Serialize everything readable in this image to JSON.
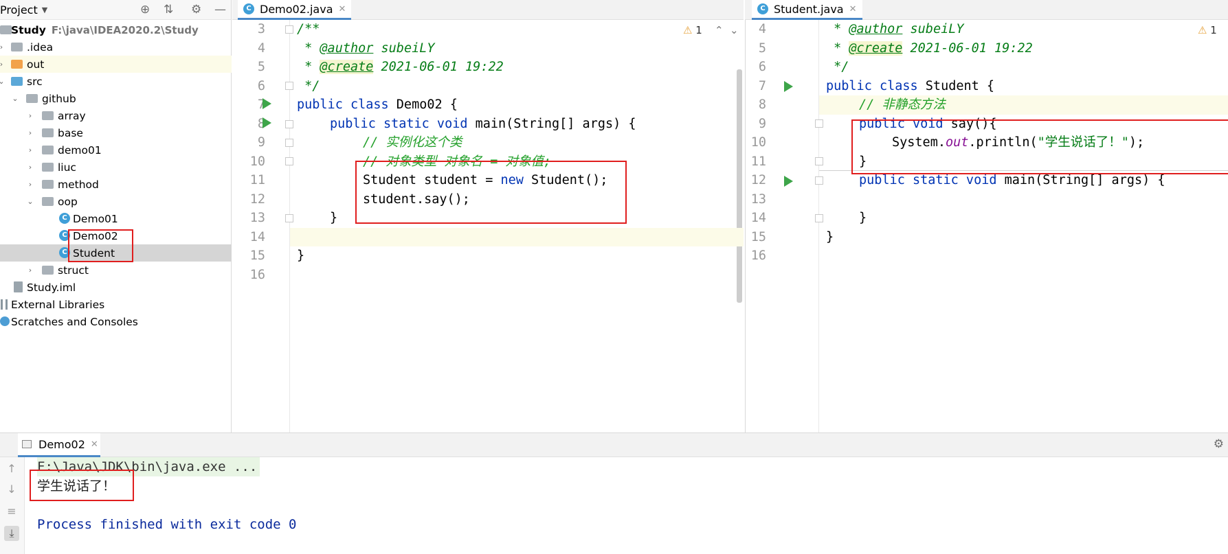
{
  "project_panel": {
    "title": "Project",
    "tree": [
      {
        "label": "Study",
        "path": "F:\\java\\IDEA2020.2\\Study",
        "icon": "module-folder-icon",
        "bold": true
      },
      {
        "label": ".idea",
        "icon": "folder-icon"
      },
      {
        "label": "out",
        "icon": "folder-orange-icon"
      },
      {
        "label": "src",
        "icon": "source-folder-icon"
      },
      {
        "label": "github",
        "icon": "package-icon"
      },
      {
        "label": "array",
        "icon": "package-icon"
      },
      {
        "label": "base",
        "icon": "package-icon"
      },
      {
        "label": "demo01",
        "icon": "package-icon"
      },
      {
        "label": "liuc",
        "icon": "package-icon"
      },
      {
        "label": "method",
        "icon": "package-icon"
      },
      {
        "label": "oop",
        "icon": "package-icon"
      },
      {
        "label": "Demo01",
        "icon": "class-icon"
      },
      {
        "label": "Demo02",
        "icon": "class-icon"
      },
      {
        "label": "Student",
        "icon": "class-icon",
        "selected": true
      },
      {
        "label": "struct",
        "icon": "package-icon"
      },
      {
        "label": "Study.iml",
        "icon": "iml-file-icon"
      },
      {
        "label": "External Libraries",
        "icon": "library-icon"
      },
      {
        "label": "Scratches and Consoles",
        "icon": "scratch-icon"
      }
    ]
  },
  "left_editor": {
    "tab_label": "Demo02.java",
    "warning_count": "1",
    "line_numbers": [
      "3",
      "4",
      "5",
      "6",
      "7",
      "8",
      "9",
      "10",
      "11",
      "12",
      "13",
      "14",
      "15",
      "16"
    ],
    "code": {
      "l3": "/**",
      "l4_star": " * ",
      "l4_tag": "@author",
      "l4_val": " subeiLY",
      "l5_star": " * ",
      "l5_tag": "@create",
      "l5_val": " 2021-06-01 19:22",
      "l6": " */",
      "l7_kw": "public class",
      "l7_rest": " Demo02 {",
      "l8_kw": "public static void",
      "l8_rest": " main(String[] args) {",
      "l9": "// 实例化这个类",
      "l10": "// 对象类型 对象名 = 对象值;",
      "l11_a": "Student student = ",
      "l11_kw": "new",
      "l11_b": " Student();",
      "l12": "student.say();",
      "l13": "}",
      "l15": "}"
    }
  },
  "right_editor": {
    "tab_label": "Student.java",
    "warning_count": "1",
    "line_numbers": [
      "4",
      "5",
      "6",
      "7",
      "8",
      "9",
      "10",
      "11",
      "12",
      "13",
      "14",
      "15",
      "16"
    ],
    "code": {
      "l4_star": " * ",
      "l4_tag": "@author",
      "l4_val": " subeiLY",
      "l5_star": " * ",
      "l5_tag": "@create",
      "l5_val": " 2021-06-01 19:22",
      "l6": " */",
      "l7_kw": "public class",
      "l7_rest": " Student {",
      "l8": "// 非静态方法",
      "l9_kw": "public void",
      "l9_rest": " say(){",
      "l10_a": "System.",
      "l10_fld": "out",
      "l10_b": ".println(",
      "l10_str": "\"学生说话了！\"",
      "l10_c": ");",
      "l11": "}",
      "l12_kw": "public static void",
      "l12_rest": " main(String[] args) {",
      "l14": "}",
      "l15": "}"
    }
  },
  "run_panel": {
    "tab_label": "Demo02",
    "console": {
      "command": "F:\\Java\\JDK\\bin\\java.exe ...",
      "output": "学生说话了！",
      "finished": "Process finished with exit code 0"
    }
  }
}
